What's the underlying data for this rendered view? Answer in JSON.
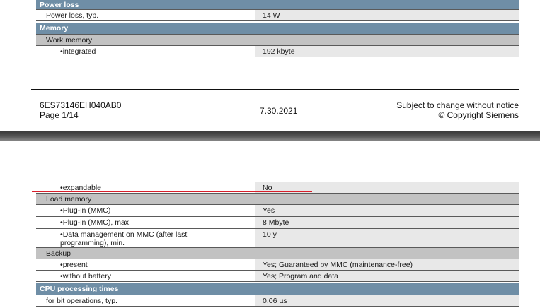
{
  "page1": {
    "section_power": "Power loss",
    "power_loss_label": "Power loss, typ.",
    "power_loss_value": "14 W",
    "section_memory": "Memory",
    "work_memory": "Work memory",
    "integrated_label": "integrated",
    "integrated_value": "192 kbyte",
    "footer": {
      "order_no": "6ES73146EH040AB0",
      "page": "Page 1/14",
      "date": "7.30.2021",
      "notice": "Subject to change without notice",
      "copyright": "© Copyright Siemens"
    }
  },
  "page2": {
    "expandable_label": "expandable",
    "expandable_value": "No",
    "load_memory": "Load memory",
    "plugin_label": "Plug-in (MMC)",
    "plugin_value": "Yes",
    "plugin_max_label": "Plug-in (MMC), max.",
    "plugin_max_value": "8 Mbyte",
    "data_mgmt_label_1": "Data management on MMC (after last",
    "data_mgmt_label_2": "programming), min.",
    "data_mgmt_value": "10 y",
    "backup": "Backup",
    "present_label": "present",
    "present_value": "Yes; Guaranteed by MMC (maintenance-free)",
    "without_battery_label": "without battery",
    "without_battery_value": "Yes; Program and data",
    "section_cpu": "CPU processing times",
    "bit_ops_label": "for bit operations, typ.",
    "bit_ops_value": "0.06 µs"
  },
  "colors": {
    "section_header": "#6f8ea6",
    "subheader": "#c2c2c2",
    "value_cell": "#e8e8e8",
    "annotation_line": "#d81e2a"
  }
}
